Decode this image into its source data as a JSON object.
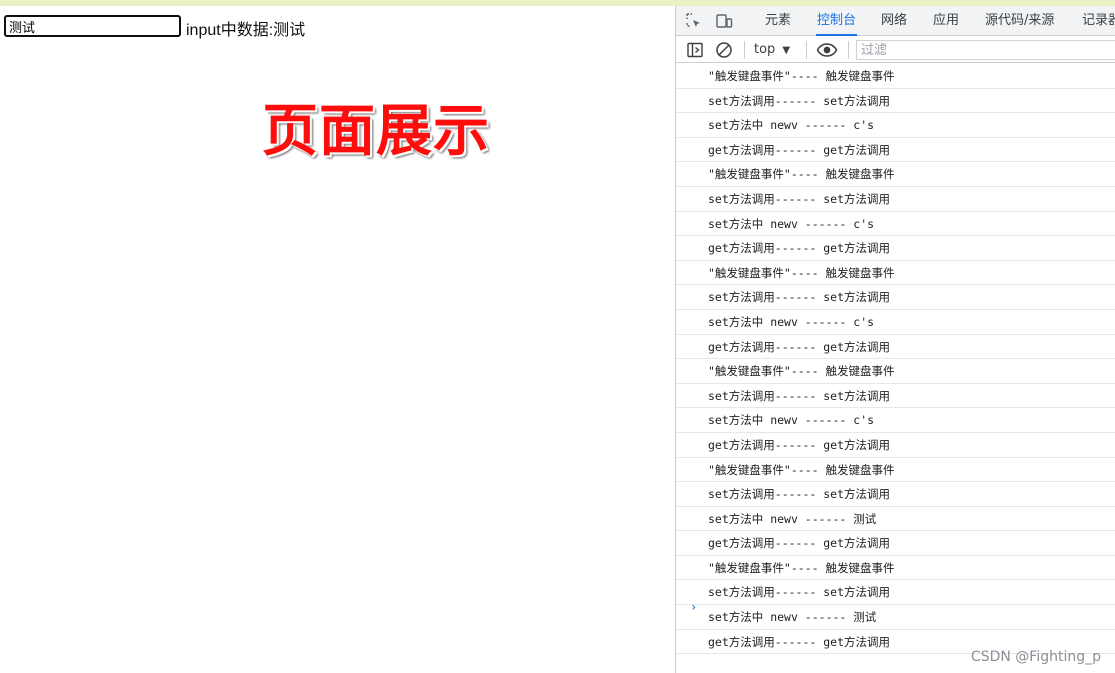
{
  "page": {
    "input_value": "测试",
    "input_display": "input中数据:测试",
    "heading": "页面展示"
  },
  "devtools": {
    "tabs": [
      {
        "label": "元素",
        "active": false
      },
      {
        "label": "控制台",
        "active": true
      },
      {
        "label": "网络",
        "active": false
      },
      {
        "label": "应用",
        "active": false
      },
      {
        "label": "源代码/来源",
        "active": false
      },
      {
        "label": "记录器",
        "active": false
      }
    ],
    "toolbar": {
      "context": "top",
      "filter_placeholder": "过滤"
    },
    "console_lines": [
      "\"触发键盘事件\"---- 触发键盘事件",
      "set方法调用------ set方法调用",
      "set方法中 newv ------ c's",
      "get方法调用------ get方法调用",
      "\"触发键盘事件\"---- 触发键盘事件",
      "set方法调用------ set方法调用",
      "set方法中 newv ------ c's",
      "get方法调用------ get方法调用",
      "\"触发键盘事件\"---- 触发键盘事件",
      "set方法调用------ set方法调用",
      "set方法中 newv ------ c's",
      "get方法调用------ get方法调用",
      "\"触发键盘事件\"---- 触发键盘事件",
      "set方法调用------ set方法调用",
      "set方法中 newv ------ c's",
      "get方法调用------ get方法调用",
      "\"触发键盘事件\"---- 触发键盘事件",
      "set方法调用------ set方法调用",
      "set方法中 newv ------ 测试",
      "get方法调用------ get方法调用",
      "\"触发键盘事件\"---- 触发键盘事件",
      "set方法调用------ set方法调用",
      "set方法中 newv ------ 测试",
      "get方法调用------ get方法调用"
    ],
    "prompt_symbol": "›"
  },
  "watermark": "CSDN @Fighting_p",
  "icons": {
    "inspect": "inspect-element-icon",
    "device": "device-toolbar-icon",
    "sidebar": "sidebar-toggle-icon",
    "clear": "clear-console-icon",
    "eye": "live-expression-eye-icon"
  }
}
